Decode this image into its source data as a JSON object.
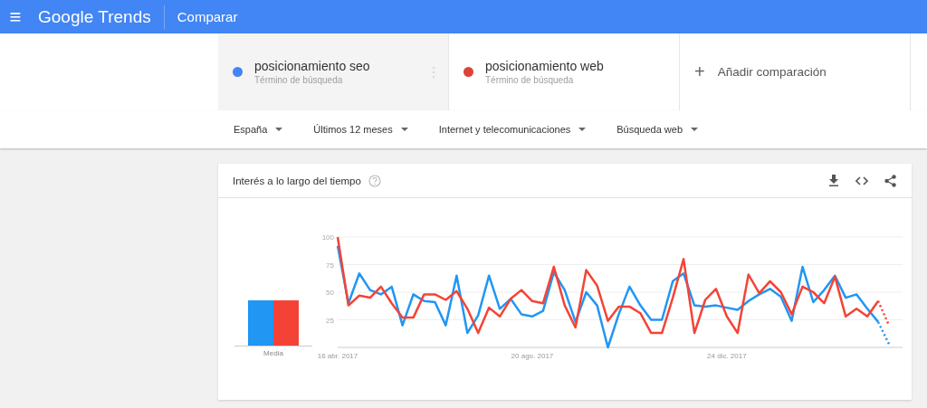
{
  "header": {
    "menu": "≡",
    "logo_google": "Google",
    "logo_trends": "Trends",
    "title": "Comparar"
  },
  "terms": [
    {
      "name": "posicionamiento seo",
      "subtitle": "Término de búsqueda",
      "color": "#4285f4",
      "selected": true
    },
    {
      "name": "posicionamiento web",
      "subtitle": "Término de búsqueda",
      "color": "#db4437",
      "selected": false
    }
  ],
  "add_comparison": {
    "icon": "+",
    "label": "Añadir comparación"
  },
  "filters": [
    "España",
    "Últimos 12 meses",
    "Internet y telecomunicaciones",
    "Búsqueda web"
  ],
  "card": {
    "title": "Interés a lo largo del tiempo",
    "average_label": "Media",
    "chart_data": {
      "type": "line",
      "grid": true,
      "categories": [
        "16 abr. 2017",
        null,
        null,
        null,
        null,
        null,
        null,
        null,
        null,
        null,
        null,
        null,
        null,
        null,
        null,
        null,
        null,
        null,
        "20 ago. 2017",
        null,
        null,
        null,
        null,
        null,
        null,
        null,
        null,
        null,
        null,
        null,
        null,
        null,
        null,
        null,
        null,
        null,
        "24 dic. 2017",
        null,
        null,
        null,
        null,
        null,
        null,
        null,
        null,
        null,
        null,
        null,
        null,
        null,
        null,
        null
      ],
      "series": [
        {
          "color": "#2196f3",
          "values": [
            92,
            40,
            67,
            52,
            48,
            55,
            20,
            48,
            42,
            41,
            20,
            65,
            13,
            29,
            65,
            35,
            44,
            30,
            28,
            33,
            68,
            52,
            23,
            50,
            38,
            0,
            30,
            55,
            38,
            25,
            25,
            60,
            67,
            38,
            37,
            38,
            36,
            34,
            42,
            48,
            53,
            46,
            24,
            73,
            41,
            52,
            65,
            45,
            48,
            35,
            23,
            3
          ]
        },
        {
          "color": "#f44336",
          "values": [
            100,
            38,
            47,
            45,
            55,
            40,
            27,
            27,
            48,
            48,
            43,
            51,
            35,
            13,
            36,
            28,
            44,
            52,
            42,
            40,
            73,
            38,
            18,
            70,
            56,
            24,
            37,
            37,
            31,
            13,
            13,
            45,
            80,
            13,
            43,
            53,
            28,
            13,
            66,
            49,
            60,
            50,
            30,
            55,
            50,
            40,
            64,
            28,
            35,
            28,
            42,
            20
          ]
        }
      ],
      "ylim": [
        0,
        100
      ],
      "yticks": [
        25,
        50,
        75,
        100
      ]
    }
  }
}
